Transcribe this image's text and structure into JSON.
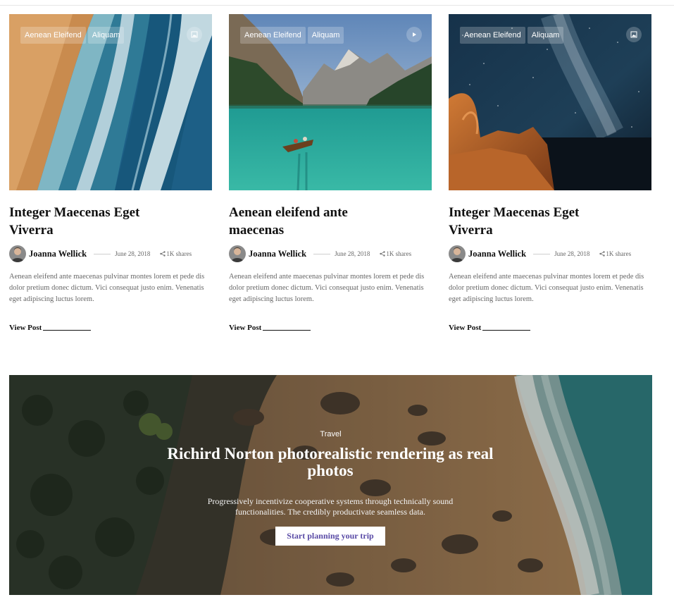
{
  "cards": [
    {
      "tags": [
        "Aenean Eleifend",
        "Aliquam"
      ],
      "media_icon": "image-icon",
      "title": "Integer Maecenas Eget Viverra",
      "author": "Joanna Wellick",
      "date": "June 28, 2018",
      "shares": "1K shares",
      "excerpt": "Aenean eleifend ante maecenas pulvinar montes lorem et pede dis dolor pretium donec dictum. Vici consequat justo enim. Venenatis eget adipiscing luctus lorem.",
      "link_label": "View Post"
    },
    {
      "tags": [
        "Aenean Eleifend",
        "Aliquam"
      ],
      "media_icon": "play-icon",
      "title": "Aenean eleifend ante maecenas",
      "author": "Joanna Wellick",
      "date": "June 28, 2018",
      "shares": "1K shares",
      "excerpt": "Aenean eleifend ante maecenas pulvinar montes lorem et pede dis dolor pretium donec dictum. Vici consequat justo enim. Venenatis eget adipiscing luctus lorem.",
      "link_label": "View Post"
    },
    {
      "tags": [
        "Aenean Eleifend",
        "Aliquam"
      ],
      "media_icon": "image-icon",
      "title": "Integer Maecenas Eget Viverra",
      "author": "Joanna Wellick",
      "date": "June 28, 2018",
      "shares": "1K shares",
      "excerpt": "Aenean eleifend ante maecenas pulvinar montes lorem et pede dis dolor pretium donec dictum. Vici consequat justo enim. Venenatis eget adipiscing luctus lorem.",
      "link_label": "View Post"
    }
  ],
  "hero": {
    "kicker": "Travel",
    "title": "Richird Norton photorealistic rendering as real photos",
    "description": "Progressively incentivize cooperative systems through technically sound functionalities. The credibly productivate seamless data.",
    "button_label": "Start planning your trip"
  },
  "colors": {
    "button_text": "#5a4ba6",
    "excerpt_text": "#666666"
  }
}
